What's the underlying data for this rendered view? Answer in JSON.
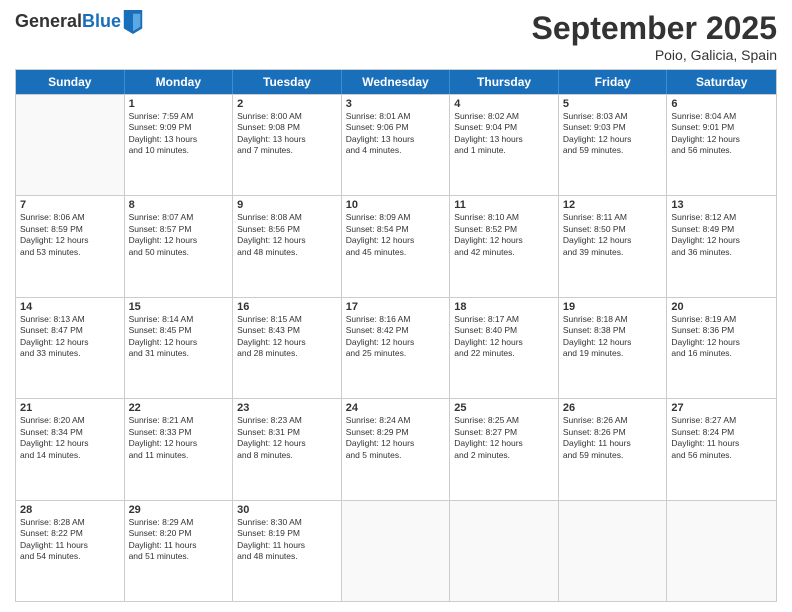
{
  "header": {
    "logo_general": "General",
    "logo_blue": "Blue",
    "month_title": "September 2025",
    "subtitle": "Poio, Galicia, Spain"
  },
  "weekdays": [
    "Sunday",
    "Monday",
    "Tuesday",
    "Wednesday",
    "Thursday",
    "Friday",
    "Saturday"
  ],
  "rows": [
    [
      {
        "day": "",
        "info": ""
      },
      {
        "day": "1",
        "info": "Sunrise: 7:59 AM\nSunset: 9:09 PM\nDaylight: 13 hours\nand 10 minutes."
      },
      {
        "day": "2",
        "info": "Sunrise: 8:00 AM\nSunset: 9:08 PM\nDaylight: 13 hours\nand 7 minutes."
      },
      {
        "day": "3",
        "info": "Sunrise: 8:01 AM\nSunset: 9:06 PM\nDaylight: 13 hours\nand 4 minutes."
      },
      {
        "day": "4",
        "info": "Sunrise: 8:02 AM\nSunset: 9:04 PM\nDaylight: 13 hours\nand 1 minute."
      },
      {
        "day": "5",
        "info": "Sunrise: 8:03 AM\nSunset: 9:03 PM\nDaylight: 12 hours\nand 59 minutes."
      },
      {
        "day": "6",
        "info": "Sunrise: 8:04 AM\nSunset: 9:01 PM\nDaylight: 12 hours\nand 56 minutes."
      }
    ],
    [
      {
        "day": "7",
        "info": "Sunrise: 8:06 AM\nSunset: 8:59 PM\nDaylight: 12 hours\nand 53 minutes."
      },
      {
        "day": "8",
        "info": "Sunrise: 8:07 AM\nSunset: 8:57 PM\nDaylight: 12 hours\nand 50 minutes."
      },
      {
        "day": "9",
        "info": "Sunrise: 8:08 AM\nSunset: 8:56 PM\nDaylight: 12 hours\nand 48 minutes."
      },
      {
        "day": "10",
        "info": "Sunrise: 8:09 AM\nSunset: 8:54 PM\nDaylight: 12 hours\nand 45 minutes."
      },
      {
        "day": "11",
        "info": "Sunrise: 8:10 AM\nSunset: 8:52 PM\nDaylight: 12 hours\nand 42 minutes."
      },
      {
        "day": "12",
        "info": "Sunrise: 8:11 AM\nSunset: 8:50 PM\nDaylight: 12 hours\nand 39 minutes."
      },
      {
        "day": "13",
        "info": "Sunrise: 8:12 AM\nSunset: 8:49 PM\nDaylight: 12 hours\nand 36 minutes."
      }
    ],
    [
      {
        "day": "14",
        "info": "Sunrise: 8:13 AM\nSunset: 8:47 PM\nDaylight: 12 hours\nand 33 minutes."
      },
      {
        "day": "15",
        "info": "Sunrise: 8:14 AM\nSunset: 8:45 PM\nDaylight: 12 hours\nand 31 minutes."
      },
      {
        "day": "16",
        "info": "Sunrise: 8:15 AM\nSunset: 8:43 PM\nDaylight: 12 hours\nand 28 minutes."
      },
      {
        "day": "17",
        "info": "Sunrise: 8:16 AM\nSunset: 8:42 PM\nDaylight: 12 hours\nand 25 minutes."
      },
      {
        "day": "18",
        "info": "Sunrise: 8:17 AM\nSunset: 8:40 PM\nDaylight: 12 hours\nand 22 minutes."
      },
      {
        "day": "19",
        "info": "Sunrise: 8:18 AM\nSunset: 8:38 PM\nDaylight: 12 hours\nand 19 minutes."
      },
      {
        "day": "20",
        "info": "Sunrise: 8:19 AM\nSunset: 8:36 PM\nDaylight: 12 hours\nand 16 minutes."
      }
    ],
    [
      {
        "day": "21",
        "info": "Sunrise: 8:20 AM\nSunset: 8:34 PM\nDaylight: 12 hours\nand 14 minutes."
      },
      {
        "day": "22",
        "info": "Sunrise: 8:21 AM\nSunset: 8:33 PM\nDaylight: 12 hours\nand 11 minutes."
      },
      {
        "day": "23",
        "info": "Sunrise: 8:23 AM\nSunset: 8:31 PM\nDaylight: 12 hours\nand 8 minutes."
      },
      {
        "day": "24",
        "info": "Sunrise: 8:24 AM\nSunset: 8:29 PM\nDaylight: 12 hours\nand 5 minutes."
      },
      {
        "day": "25",
        "info": "Sunrise: 8:25 AM\nSunset: 8:27 PM\nDaylight: 12 hours\nand 2 minutes."
      },
      {
        "day": "26",
        "info": "Sunrise: 8:26 AM\nSunset: 8:26 PM\nDaylight: 11 hours\nand 59 minutes."
      },
      {
        "day": "27",
        "info": "Sunrise: 8:27 AM\nSunset: 8:24 PM\nDaylight: 11 hours\nand 56 minutes."
      }
    ],
    [
      {
        "day": "28",
        "info": "Sunrise: 8:28 AM\nSunset: 8:22 PM\nDaylight: 11 hours\nand 54 minutes."
      },
      {
        "day": "29",
        "info": "Sunrise: 8:29 AM\nSunset: 8:20 PM\nDaylight: 11 hours\nand 51 minutes."
      },
      {
        "day": "30",
        "info": "Sunrise: 8:30 AM\nSunset: 8:19 PM\nDaylight: 11 hours\nand 48 minutes."
      },
      {
        "day": "",
        "info": ""
      },
      {
        "day": "",
        "info": ""
      },
      {
        "day": "",
        "info": ""
      },
      {
        "day": "",
        "info": ""
      }
    ]
  ]
}
